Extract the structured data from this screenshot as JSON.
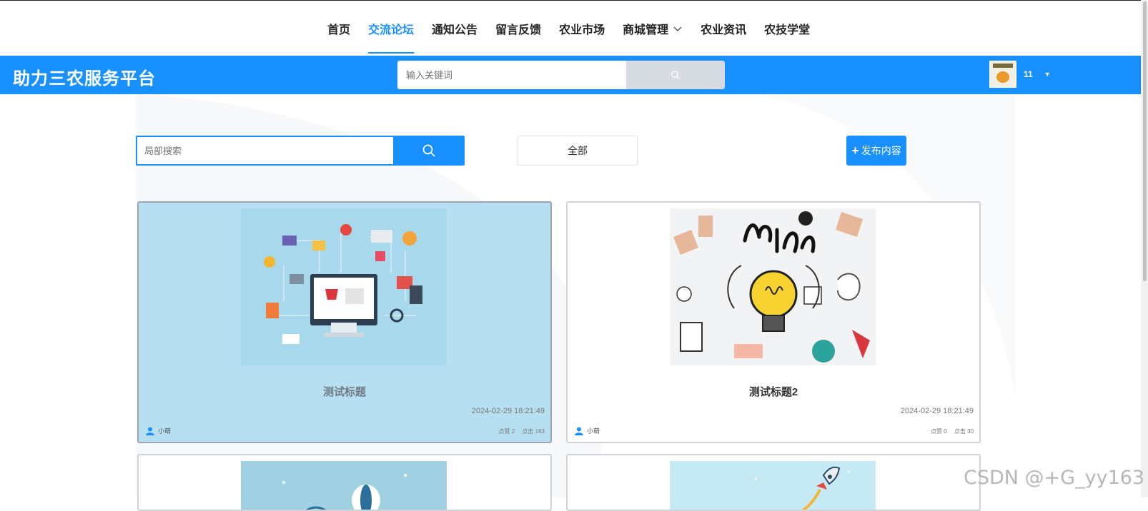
{
  "nav": {
    "items": [
      {
        "label": "首页",
        "active": false
      },
      {
        "label": "交流论坛",
        "active": true
      },
      {
        "label": "通知公告",
        "active": false
      },
      {
        "label": "留言反馈",
        "active": false
      },
      {
        "label": "农业市场",
        "active": false
      },
      {
        "label": "商城管理",
        "active": false,
        "dropdown": true
      },
      {
        "label": "农业资讯",
        "active": false
      },
      {
        "label": "农技学堂",
        "active": false
      }
    ],
    "accent": "#1890ff"
  },
  "header": {
    "brand": "助力三农服务平台",
    "search_placeholder": "输入关键词",
    "user_name": "11",
    "bg": "#1890ff"
  },
  "toolbar": {
    "local_search_placeholder": "局部搜索",
    "filter_all": "全部",
    "publish_label": "发布内容"
  },
  "posts": [
    {
      "title": "测试标题",
      "date": "2024-02-29 18:21:49",
      "author": "小萌",
      "likes": "点赞 2",
      "views": "点击 163",
      "image": "ecommerce-illustration",
      "highlighted": true
    },
    {
      "title": "测试标题2",
      "date": "2024-02-29 18:21:49",
      "author": "小萌",
      "likes": "点赞 0",
      "views": "点击 30",
      "image": "learn-lightbulb-illustration",
      "highlighted": false
    },
    {
      "image": "hot-air-balloon-illustration"
    },
    {
      "image": "rocket-illustration"
    }
  ],
  "watermark": "CSDN @+G_yy163"
}
